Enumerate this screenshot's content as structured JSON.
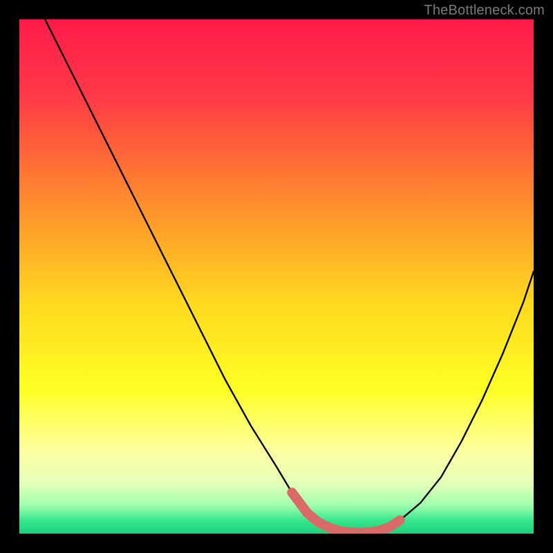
{
  "watermark": "TheBottleneck.com",
  "gradient_stops": [
    {
      "offset": 0.0,
      "color": "#ff1b4a"
    },
    {
      "offset": 0.15,
      "color": "#ff3946"
    },
    {
      "offset": 0.35,
      "color": "#ff8a2e"
    },
    {
      "offset": 0.55,
      "color": "#ffd81f"
    },
    {
      "offset": 0.72,
      "color": "#ffff24"
    },
    {
      "offset": 0.84,
      "color": "#fdffa2"
    },
    {
      "offset": 0.905,
      "color": "#e2ffb8"
    },
    {
      "offset": 0.945,
      "color": "#9effae"
    },
    {
      "offset": 0.975,
      "color": "#35e68b"
    },
    {
      "offset": 1.0,
      "color": "#1bd07e"
    }
  ],
  "curve": {
    "stroke": "#000000",
    "stroke_width": 2.4
  },
  "highlight": {
    "stroke": "#d96a68",
    "stroke_width": 14
  },
  "chart_data": {
    "type": "line",
    "title": "",
    "xlabel": "",
    "ylabel": "",
    "x_range": [
      0,
      100
    ],
    "y_range": [
      0,
      100
    ],
    "series": [
      {
        "name": "bottleneck-curve",
        "x": [
          0,
          5,
          10,
          15,
          20,
          25,
          30,
          35,
          40,
          45,
          50,
          53,
          56,
          58,
          60,
          62,
          64,
          66,
          68,
          70,
          72,
          74,
          78,
          82,
          86,
          90,
          94,
          98,
          100
        ],
        "y": [
          110,
          100,
          90,
          80,
          70,
          60,
          50,
          40,
          30,
          21,
          13,
          8,
          4,
          2.3,
          1.3,
          0.6,
          0.3,
          0.2,
          0.3,
          0.6,
          1.3,
          2.6,
          6,
          11,
          18,
          26,
          35,
          45,
          51
        ]
      }
    ],
    "highlight_segment": {
      "name": "optimal-range",
      "x": [
        53,
        56,
        58,
        60,
        62,
        64,
        66,
        68,
        70,
        72,
        74
      ],
      "y": [
        8,
        4,
        2.3,
        1.3,
        0.6,
        0.3,
        0.2,
        0.3,
        0.6,
        1.3,
        2.6
      ]
    }
  }
}
